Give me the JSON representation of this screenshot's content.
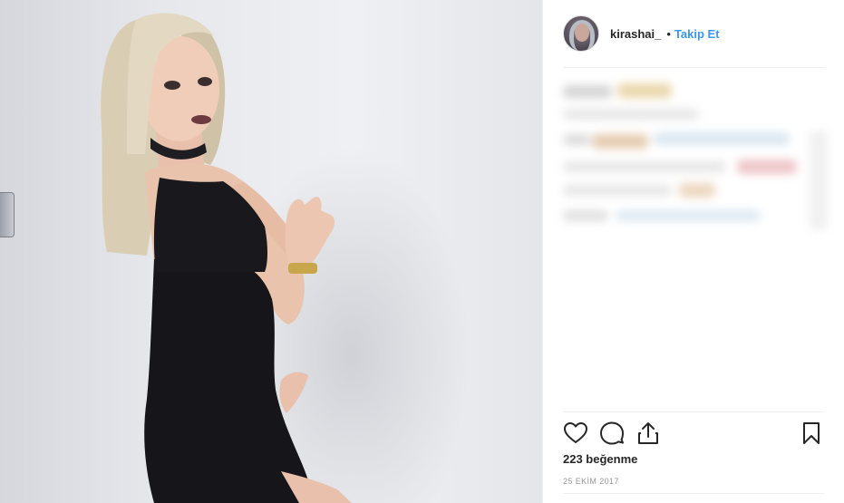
{
  "post": {
    "username": "kirashai_",
    "separator": "•",
    "follow_label": "Takip Et",
    "likes_text": "223 beğenme",
    "date_text": "25 EKİM 2017"
  },
  "icons": {
    "like": "heart-icon",
    "comment": "comment-bubble-icon",
    "share": "share-upload-icon",
    "save": "bookmark-icon"
  },
  "colors": {
    "link": "#3897f0",
    "text": "#262626",
    "muted": "#999999",
    "divider": "#efefef"
  }
}
